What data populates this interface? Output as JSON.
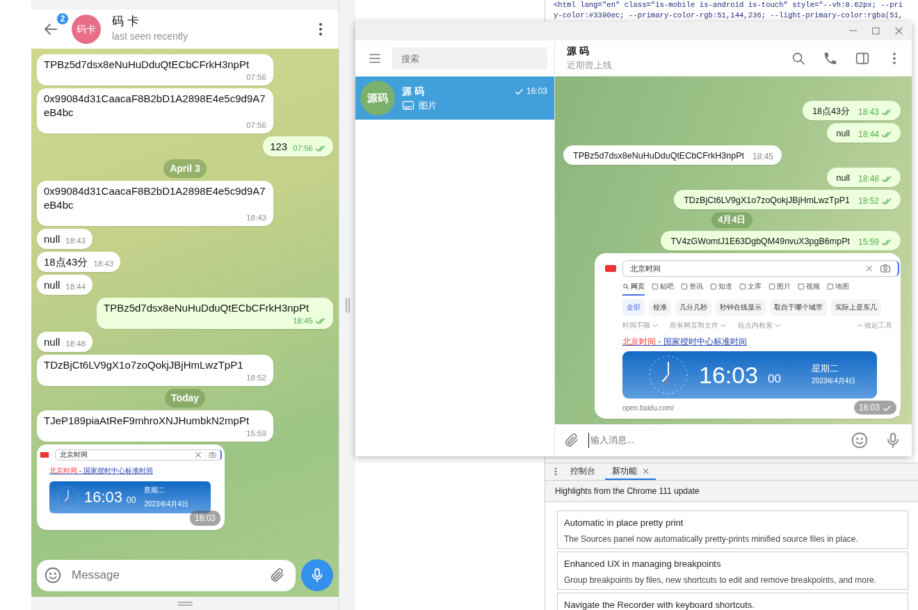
{
  "phone_chat": {
    "header": {
      "unread_badge": "2",
      "avatar_initials": "码卡",
      "name": "码 卡",
      "status": "last seen recently"
    },
    "messages": [
      {
        "kind": "text",
        "outgoing": false,
        "text": "TPBz5d7dsx8eNuHuDduQtECbCFrkH3npPt",
        "time": "07:56"
      },
      {
        "kind": "text",
        "outgoing": false,
        "text": "0x99084d31CaacaF8B2bD1A2898E4e5c9d9A7eB4bc",
        "time": "07:56"
      },
      {
        "kind": "text",
        "outgoing": true,
        "text": "123",
        "time": "07:56",
        "read": true
      },
      {
        "kind": "date",
        "text": "April 3"
      },
      {
        "kind": "text",
        "outgoing": false,
        "text": "0x99084d31CaacaF8B2bD1A2898E4e5c9d9A7eB4bc",
        "time": "18:43"
      },
      {
        "kind": "text",
        "outgoing": false,
        "text": "null",
        "time": "18:43"
      },
      {
        "kind": "text",
        "outgoing": false,
        "text": "18点43分",
        "time": "18:43"
      },
      {
        "kind": "text",
        "outgoing": false,
        "text": "null",
        "time": "18:44"
      },
      {
        "kind": "text",
        "outgoing": true,
        "text": "TPBz5d7dsx8eNuHuDduQtECbCFrkH3npPt",
        "time": "18:45",
        "read": true
      },
      {
        "kind": "text",
        "outgoing": false,
        "text": "null",
        "time": "18:48"
      },
      {
        "kind": "text",
        "outgoing": false,
        "text": "TDzBjCt6LV9gX1o7zoQokjJBjHmLwzTpP1",
        "time": "18:52"
      },
      {
        "kind": "date",
        "text": "Today"
      },
      {
        "kind": "text",
        "outgoing": false,
        "text": "TJeP189piaAtReF9mhroXNJHumbkN2mpPt",
        "time": "15:59"
      },
      {
        "kind": "image",
        "outgoing": false,
        "time": "16:03",
        "screenshot": {
          "query": "北京时间",
          "result_title_highlight": "北京时间",
          "result_title": " - 国家授时中心标准时间",
          "clock_time": "16:03",
          "clock_seconds": "00",
          "weekday": "星期二",
          "date": "2023年4月4日"
        }
      }
    ],
    "composer": {
      "placeholder": "Message"
    }
  },
  "devtools": {
    "source_lines": [
      "<html lang=\"en\" class=\"is-mobile is-android is-touch\" style=\"--vh:8.62px; --pri",
      "y-color:#3390ec; --primary-color-rgb:51,144,236; --light-primary-color:rgba(51,"
    ],
    "drawer": {
      "tabs": [
        {
          "label": "控制台",
          "selected": false
        },
        {
          "label": "新功能",
          "selected": true
        }
      ],
      "heading": "Highlights from the Chrome 111 update",
      "features": [
        {
          "title": "Automatic in place pretty print",
          "description": "The Sources panel now automatically pretty-prints minified source files in place."
        },
        {
          "title": "Enhanced UX in managing breakpoints",
          "description": "Group breakpoints by files, new shortcuts to edit and remove breakpoints, and more."
        },
        {
          "title": "Navigate the Recorder with keyboard shortcuts."
        }
      ]
    }
  },
  "desktop_window": {
    "sidebar": {
      "search_placeholder": "搜索",
      "chats": [
        {
          "avatar_initials": "源码",
          "name": "源 码",
          "time": "16:03",
          "read": false,
          "preview": "图片",
          "selected": true
        }
      ]
    },
    "chat": {
      "name": "源 码",
      "status": "近期曾上线",
      "messages": [
        {
          "kind": "text",
          "outgoing": true,
          "text": "18点43分",
          "time": "18:43",
          "read": true
        },
        {
          "kind": "text",
          "outgoing": true,
          "text": "null",
          "time": "18:44",
          "read": true
        },
        {
          "kind": "text",
          "outgoing": false,
          "text": "TPBz5d7dsx8eNuHuDduQtECbCFrkH3npPt",
          "time": "18:45"
        },
        {
          "kind": "text",
          "outgoing": true,
          "text": "null",
          "time": "18:48",
          "read": true
        },
        {
          "kind": "text",
          "outgoing": true,
          "text": "TDzBjCt6LV9gX1o7zoQokjJBjHmLwzTpP1",
          "time": "18:52",
          "read": true
        },
        {
          "kind": "date",
          "text": "4月4日"
        },
        {
          "kind": "text",
          "outgoing": true,
          "text": "TV4zGWomtJ1E63DgbQM49nvuX3pgB6mpPt",
          "time": "15:59",
          "read": true
        },
        {
          "kind": "image",
          "outgoing": true,
          "time": "16:03",
          "read": false,
          "screenshot": {
            "query": "北京时间",
            "tabs": [
              {
                "label": "网页",
                "selected": true
              },
              {
                "label": "贴吧",
                "selected": false
              },
              {
                "label": "资讯",
                "selected": false
              },
              {
                "label": "知道",
                "selected": false
              },
              {
                "label": "文库",
                "selected": false
              },
              {
                "label": "图片",
                "selected": false
              },
              {
                "label": "视频",
                "selected": false
              },
              {
                "label": "地图",
                "selected": false
              }
            ],
            "chips": [
              {
                "label": "全部",
                "selected": true
              },
              {
                "label": "校准",
                "selected": false
              },
              {
                "label": "几分几秒",
                "selected": false
              },
              {
                "label": "秒钟在线显示",
                "selected": false
              },
              {
                "label": "取自于哪个城市",
                "selected": false
              },
              {
                "label": "实际上是东几",
                "selected": false
              }
            ],
            "filters": [
              "时间不限",
              "所有网页和文件",
              "站点内检索"
            ],
            "collapse_label": "收起工具",
            "result_title_highlight": "北京时间",
            "result_title": " - 国家授时中心标准时间",
            "clock_time": "16:03",
            "clock_seconds": "00",
            "weekday": "星期二",
            "date": "2023年4月4日",
            "url": "open.baidu.com/"
          }
        }
      ],
      "composer": {
        "placeholder": "输入消息..."
      }
    }
  }
}
